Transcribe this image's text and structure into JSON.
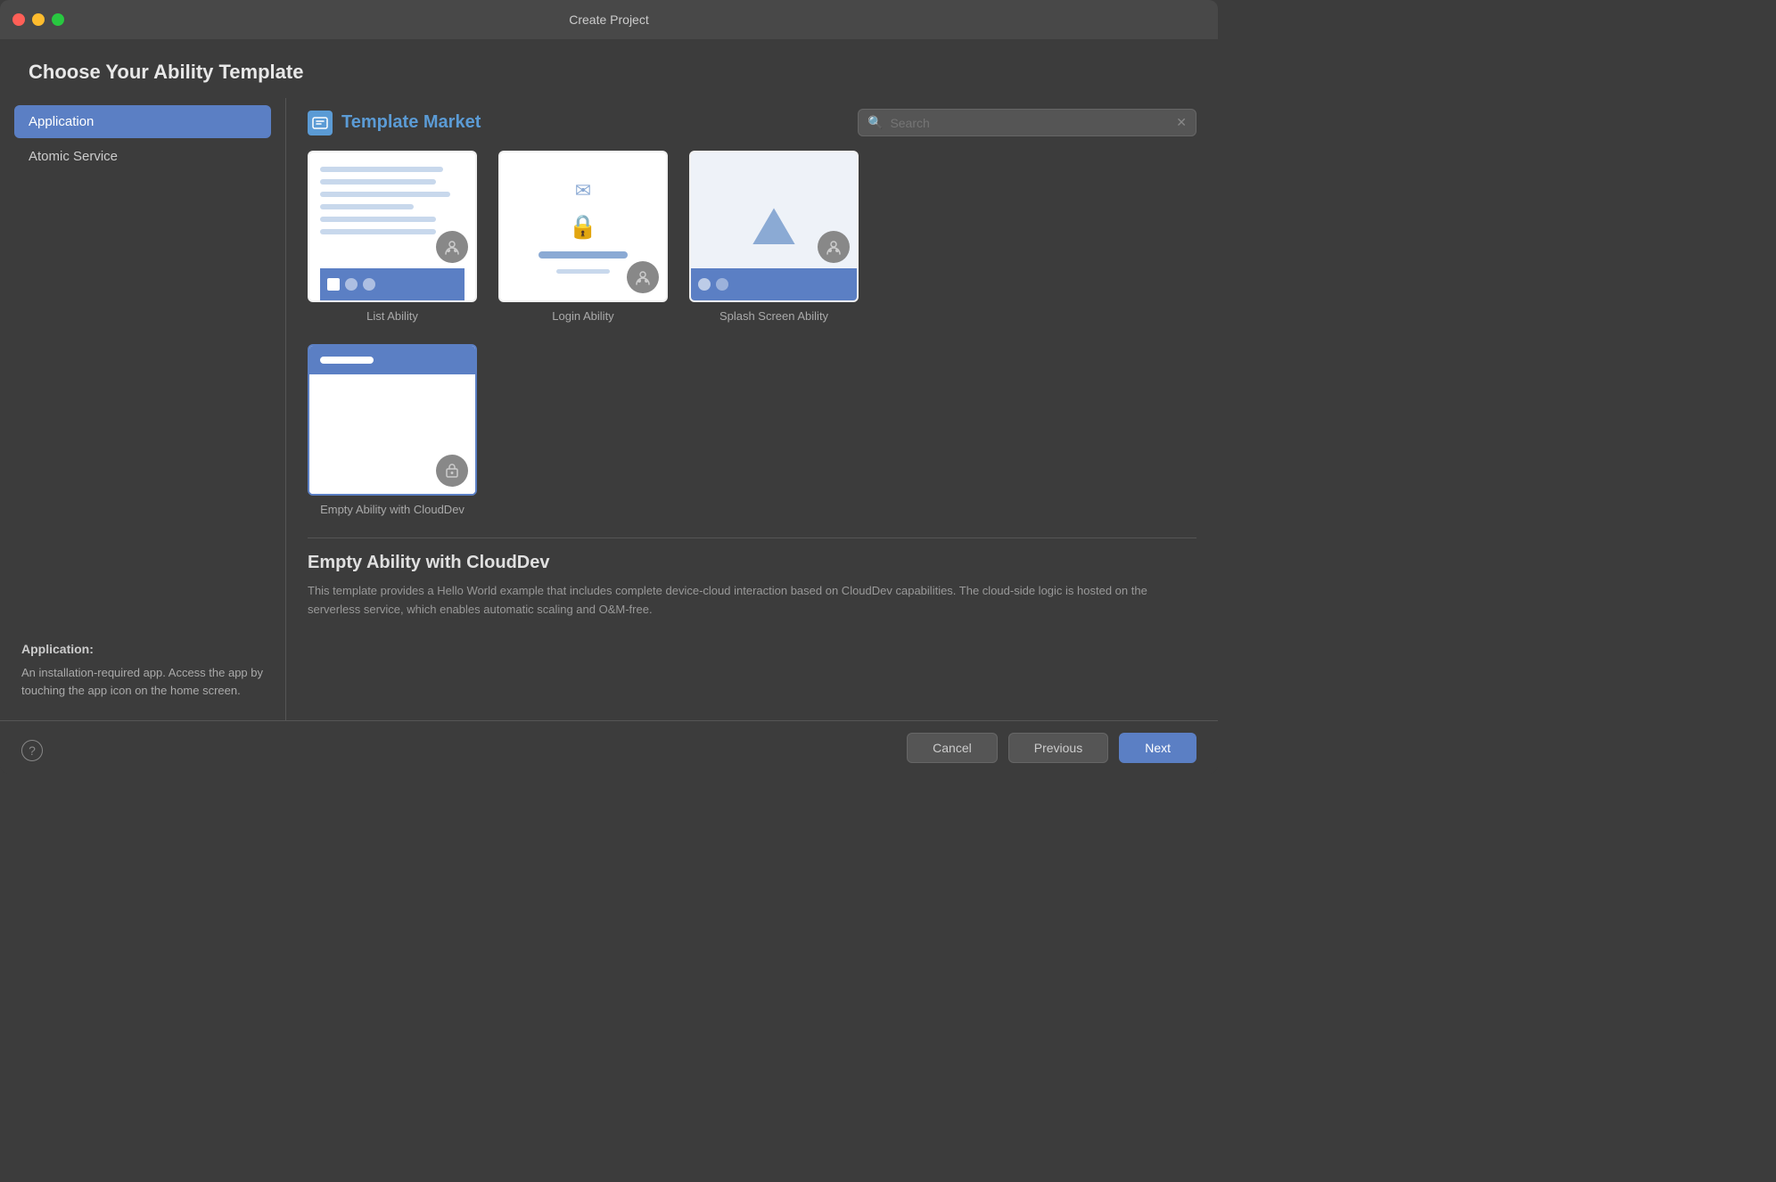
{
  "window": {
    "title": "Create Project"
  },
  "page": {
    "title": "Choose Your Ability Template"
  },
  "sidebar": {
    "items": [
      {
        "id": "application",
        "label": "Application",
        "active": true
      },
      {
        "id": "atomic-service",
        "label": "Atomic Service",
        "active": false
      }
    ],
    "description": {
      "title": "Application:",
      "text": "An installation-required app. Access the app by touching the app icon on the home screen."
    }
  },
  "content": {
    "market_title": "Template Market",
    "search_placeholder": "Search",
    "templates": [
      {
        "id": "list-ability",
        "label": "List Ability",
        "type": "list",
        "selected": false
      },
      {
        "id": "login-ability",
        "label": "Login Ability",
        "type": "login",
        "selected": false
      },
      {
        "id": "splash-screen-ability",
        "label": "Splash Screen Ability",
        "type": "splash",
        "selected": false
      },
      {
        "id": "empty-ability-clouddev",
        "label": "Empty Ability with CloudDev",
        "type": "empty-clouddev",
        "selected": true
      }
    ],
    "selected_template": {
      "title": "Empty Ability with CloudDev",
      "description": "This template provides a Hello World example that includes complete device-cloud interaction based on CloudDev capabilities. The cloud-side logic is hosted on the serverless service, which enables automatic scaling and O&M-free."
    }
  },
  "footer": {
    "cancel_label": "Cancel",
    "previous_label": "Previous",
    "next_label": "Next"
  },
  "help": {
    "icon": "?"
  }
}
